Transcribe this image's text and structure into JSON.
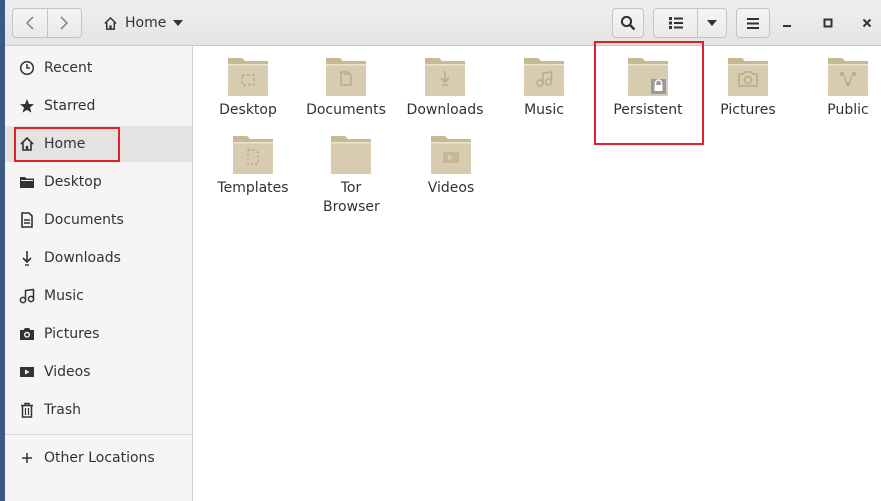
{
  "header": {
    "location_label": "Home"
  },
  "sidebar": {
    "items": [
      {
        "label": "Recent",
        "icon": "clock-icon"
      },
      {
        "label": "Starred",
        "icon": "star-icon"
      },
      {
        "label": "Home",
        "icon": "home-icon",
        "active": true
      },
      {
        "label": "Desktop",
        "icon": "folder-icon"
      },
      {
        "label": "Documents",
        "icon": "document-icon"
      },
      {
        "label": "Downloads",
        "icon": "download-icon"
      },
      {
        "label": "Music",
        "icon": "music-icon"
      },
      {
        "label": "Pictures",
        "icon": "camera-icon"
      },
      {
        "label": "Videos",
        "icon": "video-icon"
      },
      {
        "label": "Trash",
        "icon": "trash-icon"
      }
    ],
    "other_locations": "Other Locations"
  },
  "files": [
    {
      "label": "Desktop",
      "emblem": "desktop"
    },
    {
      "label": "Documents",
      "emblem": "documents"
    },
    {
      "label": "Downloads",
      "emblem": "downloads"
    },
    {
      "label": "Music",
      "emblem": "music"
    },
    {
      "label": "Persistent",
      "emblem": "lock"
    },
    {
      "label": "Pictures",
      "emblem": "camera"
    },
    {
      "label": "Public",
      "emblem": "share"
    },
    {
      "label": "Templates",
      "emblem": "template"
    },
    {
      "label": "Tor Browser",
      "emblem": "none"
    },
    {
      "label": "Videos",
      "emblem": "video"
    }
  ],
  "colors": {
    "folder": "#d8ccb0",
    "highlight": "#e0202a"
  }
}
